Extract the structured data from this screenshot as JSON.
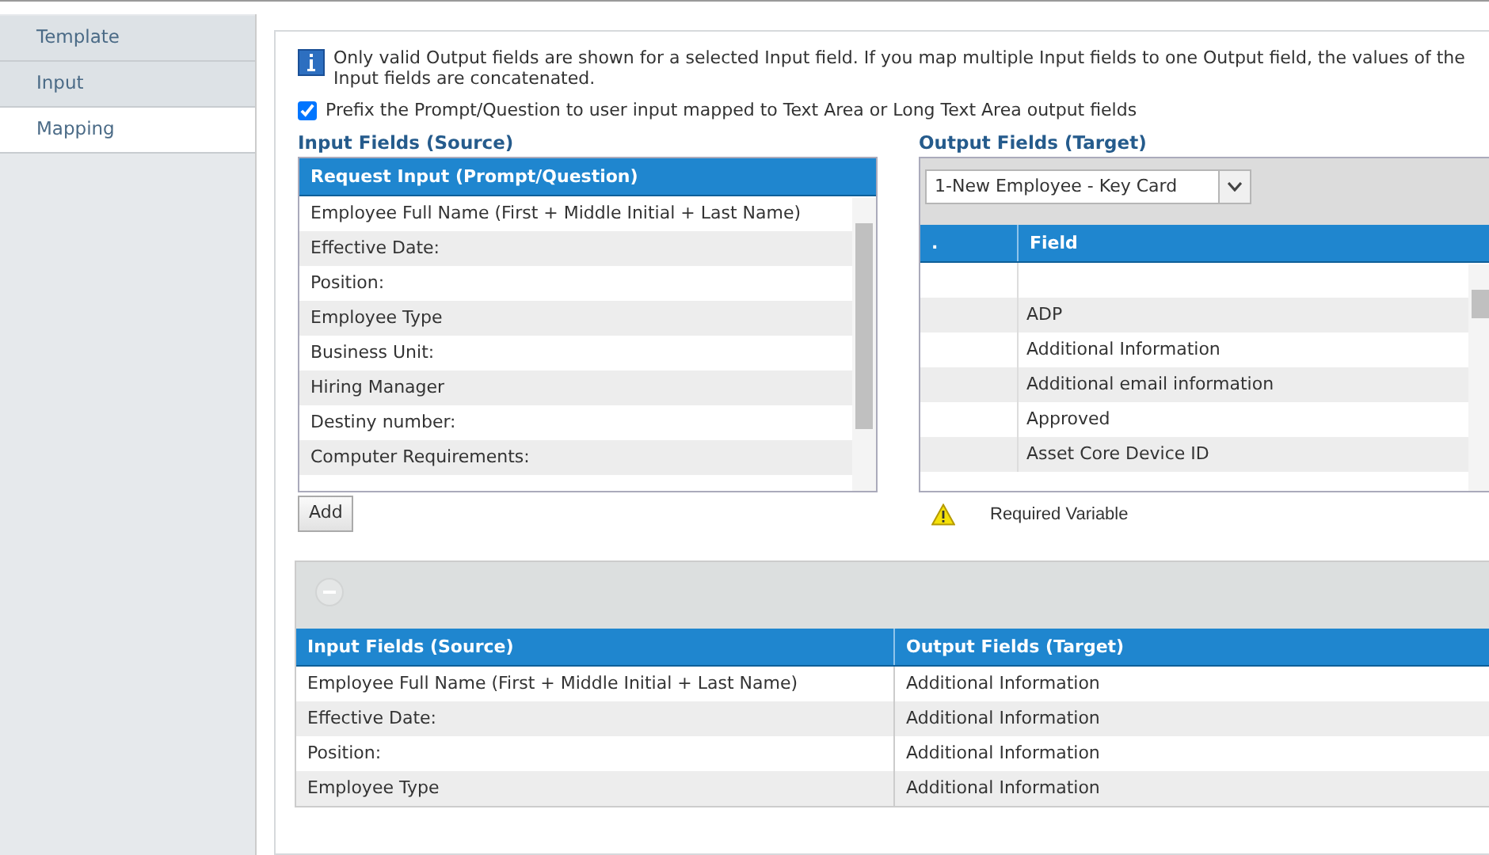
{
  "sidebar": {
    "items": [
      {
        "label": "Template",
        "selected": false
      },
      {
        "label": "Input",
        "selected": false
      },
      {
        "label": "Mapping",
        "selected": true
      }
    ]
  },
  "info": "Only valid Output fields are shown for a selected Input field. If you map multiple Input fields to one Output field, the values of the Input fields are concatenated.",
  "prefix_option": {
    "label": "Prefix the Prompt/Question to user input mapped to Text Area or Long Text Area output fields",
    "checked": true
  },
  "input_fields": {
    "title": "Input Fields (Source)",
    "column": "Request Input (Prompt/Question)",
    "rows": [
      "Employee Full Name (First + Middle Initial + Last Name)",
      "Effective Date:",
      "Position:",
      "Employee Type",
      "Business Unit:",
      "Hiring Manager",
      "Destiny number:",
      "Computer Requirements:"
    ],
    "add_button": "Add"
  },
  "output_fields": {
    "title": "Output Fields (Target)",
    "select": "1-New Employee - Key Card",
    "columns": [
      ".",
      "Field"
    ],
    "rows": [
      "",
      "ADP",
      "Additional Information",
      "Additional email information",
      "Approved",
      "Asset Core Device ID"
    ],
    "legend": "Required Variable"
  },
  "mappings": {
    "columns": [
      "Input Fields (Source)",
      "Output Fields (Target)"
    ],
    "rows": [
      [
        "Employee Full Name (First + Middle Initial + Last Name)",
        "Additional Information"
      ],
      [
        "Effective Date:",
        "Additional Information"
      ],
      [
        "Position:",
        "Additional Information"
      ],
      [
        "Employee Type",
        "Additional Information"
      ]
    ]
  }
}
